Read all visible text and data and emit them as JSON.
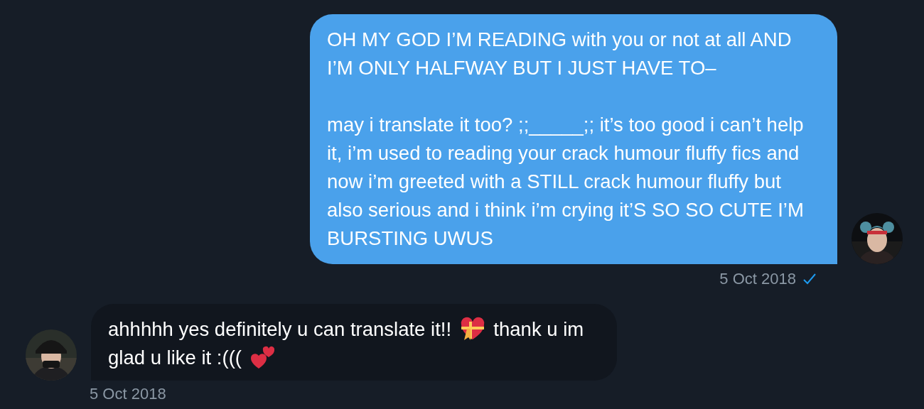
{
  "messages": [
    {
      "kind": "sent",
      "paragraphs": [
        "OH MY GOD I’M READING with you or not at all AND I’M ONLY HALFWAY BUT I JUST HAVE TO–",
        "may i translate it too? ;;_____;; it’s too good i can’t help it, i’m used to reading your crack humour fluffy fics and now i’m greeted with a STILL crack humour fluffy but also serious and i think i’m crying it’S SO SO CUTE I’M BURSTING UWUS"
      ],
      "time": "5 Oct 2018",
      "read": true
    },
    {
      "kind": "received",
      "parts": [
        {
          "kind": "text",
          "text": "ahhhhh yes definitely u can translate it!!"
        },
        {
          "kind": "gift_heart"
        },
        {
          "kind": "text",
          "text": "thank u im"
        },
        {
          "kind": "text",
          "text": "glad u like it :((("
        },
        {
          "kind": "two_hearts"
        }
      ],
      "time": "5 Oct 2018"
    }
  ]
}
